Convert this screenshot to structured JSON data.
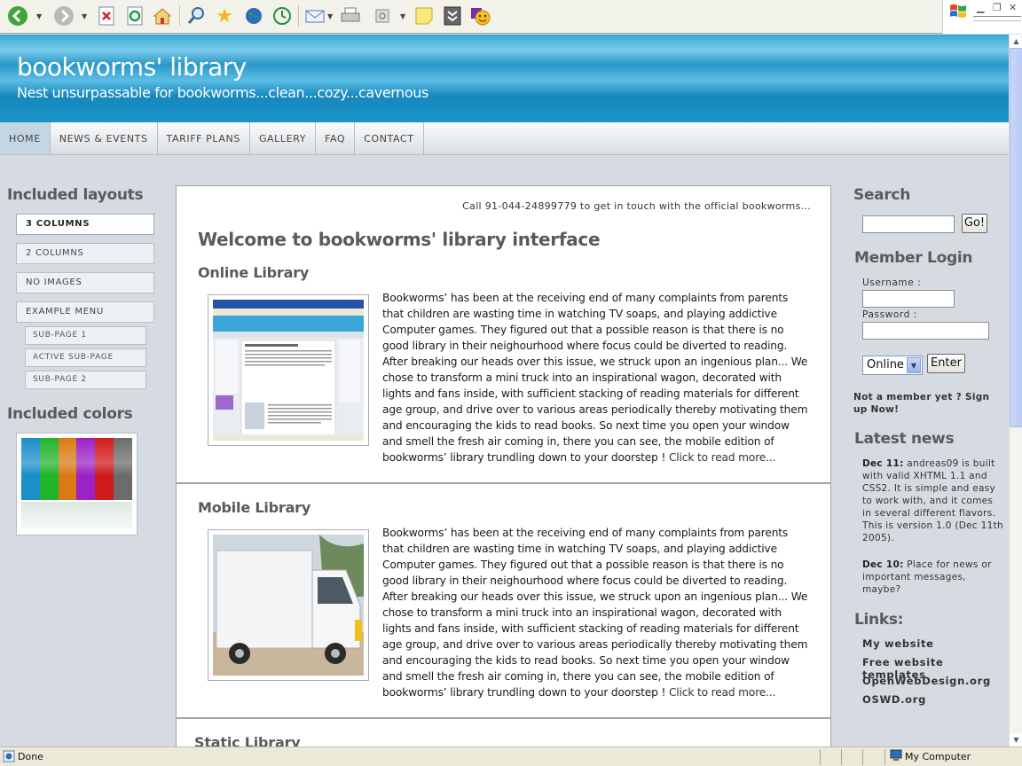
{
  "browser": {
    "toolbar_icons": [
      "back-icon",
      "forward-icon",
      "stop-icon",
      "refresh-icon",
      "home-icon",
      "search-icon",
      "favorites-icon",
      "media-icon",
      "history-icon",
      "mail-icon",
      "print-icon",
      "discuss-icon",
      "notes-icon",
      "research-icon",
      "messenger-icon"
    ],
    "status_text": "Done",
    "zone_text": "My Computer"
  },
  "site": {
    "title": "bookworms' library",
    "tagline": "Nest unsurpassable for bookworms...clean...cozy...cavernous"
  },
  "nav": {
    "items": [
      "HOME",
      "NEWS & EVENTS",
      "TARIFF PLANS",
      "GALLERY",
      "FAQ",
      "CONTACT"
    ],
    "active": "HOME"
  },
  "left": {
    "layouts_heading": "Included layouts",
    "layouts": [
      "3 COLUMNS",
      "2 COLUMNS",
      "NO IMAGES",
      "EXAMPLE MENU"
    ],
    "subpages": [
      "SUB-PAGE 1",
      "ACTIVE SUB-PAGE",
      "SUB-PAGE 2"
    ],
    "colors_heading": "Included colors",
    "swatch_colors": [
      "#1a8fc8",
      "#22b42a",
      "#d97a14",
      "#9b22c4",
      "#d11a1a",
      "#6c6c6c"
    ]
  },
  "main": {
    "phone_line": "Call 91-044-24899779 to get in touch with the official bookworms...",
    "welcome": "Welcome to bookworms' library interface",
    "sections": [
      {
        "title": "Online Library",
        "text": "Bookworms’ has been at the receiving end of many complaints from parents that children are wasting time in watching TV soaps, and playing addictive Computer games. They figured out that a possible reason is that there is no good library in their neighourhood where focus could be diverted to reading. After breaking our heads over this issue, we struck upon an ingenious plan... We chose to transform a mini truck into an inspirational wagon, decorated with lights and fans inside, with sufficient stacking of reading materials for different age group, and drive over to various areas periodically thereby motivating them and encouraging the kids to read books. So next time you open your window and smell the fresh air coming in, there you can see, the mobile edition of bookworms’ library trundling down to your doorstep !",
        "more": "Click to read more..."
      },
      {
        "title": "Mobile Library",
        "text": "Bookworms’ has been at the receiving end of many complaints from parents that children are wasting time in watching TV soaps, and playing addictive Computer games. They figured out that a possible reason is that there is no good library in their neighourhood where focus could be diverted to reading. After breaking our heads over this issue, we struck upon an ingenious plan... We chose to transform a mini truck into an inspirational wagon, decorated with lights and fans inside, with sufficient stacking of reading materials for different age group, and drive over to various areas periodically thereby motivating them and encouraging the kids to read books. So next time you open your window and smell the fresh air coming in, there you can see, the mobile edition of bookworms’ library trundling down to your doorstep !",
        "more": "Click to read more..."
      },
      {
        "title": "Static Library"
      }
    ]
  },
  "right": {
    "search_heading": "Search",
    "search_button": "Go!",
    "login_heading": "Member Login",
    "username_label": "Username :",
    "password_label": "Password :",
    "status_value": "Online",
    "enter_button": "Enter",
    "signup_text": "Not a member yet ? Sign up Now!",
    "news_heading": "Latest news",
    "news": [
      {
        "date": "Dec 11:",
        "text": "andreas09 is built with valid XHTML 1.1 and CSS2. It is simple and easy to work with, and it comes in several different flavors. This is version 1.0 (Dec 11th 2005)."
      },
      {
        "date": "Dec 10:",
        "text": "Place for news or important messages, maybe?"
      }
    ],
    "links_heading": "Links:",
    "links": [
      "My website",
      "Free website templates",
      "OpenWebDesign.org",
      "OSWD.org"
    ]
  }
}
